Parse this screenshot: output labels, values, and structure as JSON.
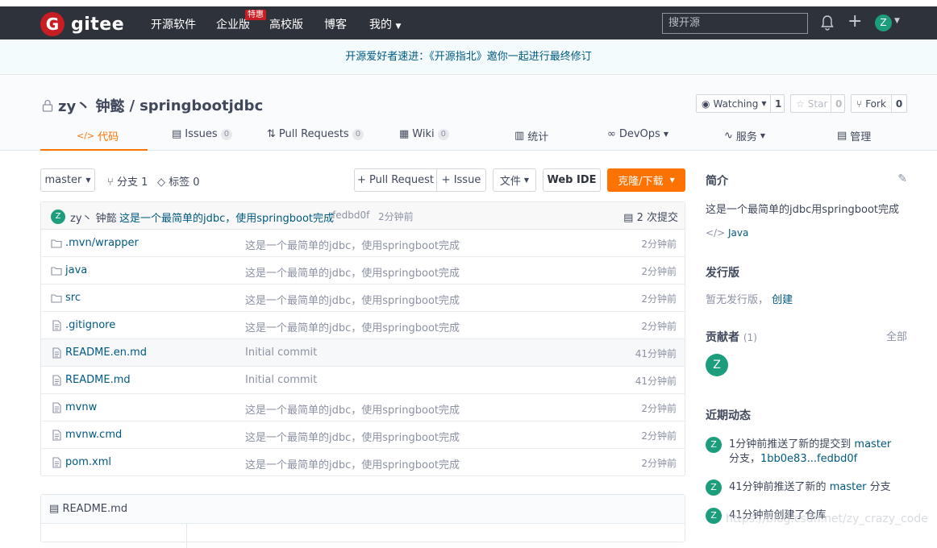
{
  "nav": {
    "logo": "gitee",
    "items": [
      "开源软件",
      "企业版",
      "高校版",
      "博客",
      "我的"
    ],
    "hot_badge": "特惠",
    "search_placeholder": "搜开源",
    "avatar": "Z"
  },
  "notice": "开源爱好者速进：《开源指北》邀你一起进行最终修订",
  "repo": {
    "owner": "zy丶 钟懿",
    "separator": "/",
    "name": "springbootjdbc",
    "watch_label": "Watching",
    "watch_count": "1",
    "star_label": "Star",
    "star_count": "0",
    "fork_label": "Fork",
    "fork_count": "0"
  },
  "tabs": [
    {
      "label": "代码",
      "count": ""
    },
    {
      "label": "Issues",
      "count": "0"
    },
    {
      "label": "Pull Requests",
      "count": "0"
    },
    {
      "label": "Wiki",
      "count": "0"
    },
    {
      "label": "统计",
      "count": ""
    },
    {
      "label": "DevOps",
      "count": ""
    },
    {
      "label": "服务",
      "count": ""
    },
    {
      "label": "管理",
      "count": ""
    }
  ],
  "toolbar": {
    "branch": "master",
    "branches": "分支 1",
    "tags": "标签 0",
    "pull_request": "+ Pull Request",
    "issue": "+ Issue",
    "file": "文件",
    "web_ide": "Web IDE",
    "clone": "克隆/下载"
  },
  "commit": {
    "avatar": "Z",
    "author": "zy丶 钟懿",
    "message": "这是一个最简单的jdbc，使用springboot完成",
    "hash": "fedbd0f",
    "time": "2分钟前",
    "count": "2 次提交"
  },
  "files": [
    {
      "icon": "folder-icon",
      "name": ".mvn/wrapper",
      "msg": "这是一个最简单的jdbc，使用springboot完成",
      "time": "2分钟前"
    },
    {
      "icon": "folder-icon",
      "name": "java",
      "msg": "这是一个最简单的jdbc，使用springboot完成",
      "time": "2分钟前"
    },
    {
      "icon": "folder-icon",
      "name": "src",
      "msg": "这是一个最简单的jdbc，使用springboot完成",
      "time": "2分钟前"
    },
    {
      "icon": "file-icon",
      "name": ".gitignore",
      "msg": "这是一个最简单的jdbc，使用springboot完成",
      "time": "2分钟前"
    },
    {
      "icon": "file-icon",
      "name": "README.en.md",
      "msg": "Initial commit",
      "time": "41分钟前"
    },
    {
      "icon": "file-icon",
      "name": "README.md",
      "msg": "Initial commit",
      "time": "41分钟前"
    },
    {
      "icon": "file-icon",
      "name": "mvnw",
      "msg": "这是一个最简单的jdbc，使用springboot完成",
      "time": "2分钟前"
    },
    {
      "icon": "file-icon",
      "name": "mvnw.cmd",
      "msg": "这是一个最简单的jdbc，使用springboot完成",
      "time": "2分钟前"
    },
    {
      "icon": "file-icon",
      "name": "pom.xml",
      "msg": "这是一个最简单的jdbc，使用springboot完成",
      "time": "2分钟前"
    }
  ],
  "readme": {
    "title": "README.md"
  },
  "sidebar": {
    "intro_title": "简介",
    "intro_text": "这是一个最简单的jdbc用springboot完成",
    "language": "Java",
    "release_title": "发行版",
    "release_text": "暂无发行版，",
    "release_create": "创建",
    "contrib_title": "贡献者",
    "contrib_count": "(1)",
    "contrib_all": "全部",
    "contrib_avatar": "Z",
    "activity_title": "近期动态",
    "activities": [
      {
        "avatar": "Z",
        "pre": "1分钟前推送了新的提交到",
        "branch": "master",
        "post": "分支，",
        "range": "1bb0e83...fedbd0f"
      },
      {
        "avatar": "Z",
        "pre": "41分钟前推送了新的",
        "branch": "master",
        "post": "分支",
        "range": ""
      },
      {
        "avatar": "Z",
        "pre": "41分钟前创建了仓库",
        "branch": "",
        "post": "",
        "range": ""
      }
    ]
  },
  "watermark": "https://blog.csdn.net/zy_crazy_code"
}
